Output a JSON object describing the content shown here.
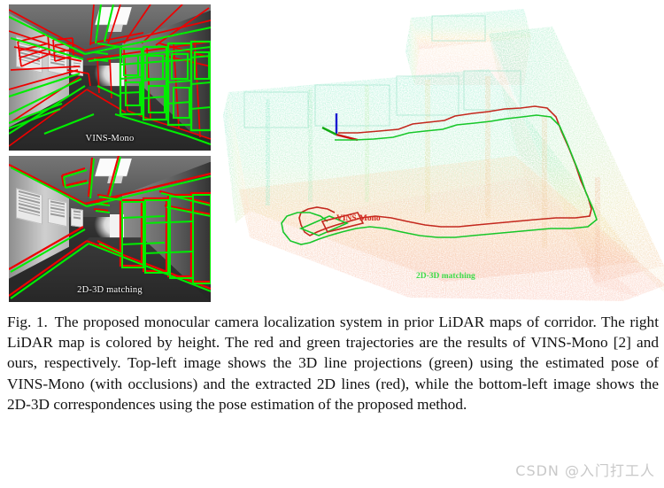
{
  "figure": {
    "panels": {
      "top_left": {
        "label": "VINS-Mono",
        "description": "grayscale corridor image with projected 3D lines in green and extracted 2D lines in red"
      },
      "bottom_left": {
        "label": "2D-3D matching",
        "description": "grayscale corridor image with aligned 2D-3D line correspondences in green and red"
      },
      "right_map": {
        "vins_label": "VINS-Mono",
        "matching_label": "2D-3D matching",
        "description": "3D LiDAR point cloud map of an L-shaped corridor colored by height"
      }
    },
    "colors": {
      "green_lines": "#00ee00",
      "red_lines": "#ee0000",
      "map_vins_label": "#d42a20",
      "map_matching_label": "#3ddc4a",
      "axis_up": "#1a1ad0",
      "axis_right": "#cc1111",
      "axis_forward": "#11aa11",
      "cloud_high": "#7fe8c8",
      "cloud_mid": "#f0d89a",
      "cloud_low": "#f2b0a0"
    }
  },
  "caption": {
    "lead": "Fig. 1.",
    "text": "The proposed monocular camera localization system in prior LiDAR maps of corridor. The right LiDAR map is colored by height. The red and green trajectories are the results of VINS-Mono [2] and ours, respectively. Top-left image shows the 3D line projections (green) using the estimated pose of VINS-Mono (with occlusions) and the extracted 2D lines (red), while the bottom-left image shows the 2D-3D correspondences using the pose estimation of the proposed method."
  },
  "watermark": {
    "text": "CSDN @入门打工人"
  }
}
